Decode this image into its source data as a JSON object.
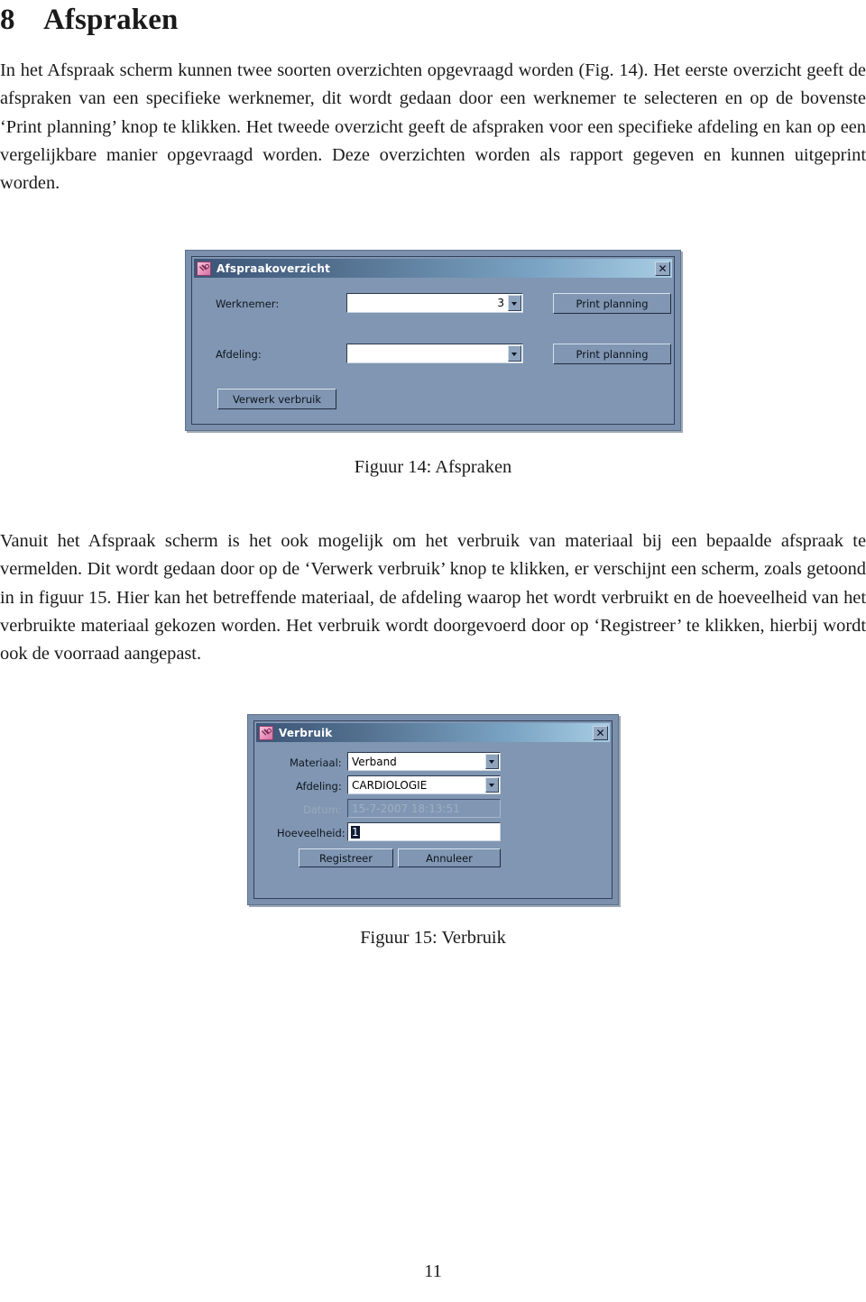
{
  "document": {
    "section_number": "8",
    "section_title": "Afspraken",
    "paragraph_1": "In het Afspraak scherm kunnen twee soorten overzichten opgevraagd worden (Fig. 14). Het eerste overzicht geeft de afspraken van een specifieke werknemer, dit wordt gedaan door een werknemer te selecteren en op de bovenste ‘Print planning’ knop te klikken. Het tweede overzicht geeft de afspraken voor een specifieke afdeling en kan op een vergelijkbare manier opgevraagd worden. Deze overzichten worden als rapport gegeven en kunnen uitgeprint worden.",
    "figure_14_caption": "Figuur 14: Afspraken",
    "paragraph_2": "Vanuit het Afspraak scherm is het ook mogelijk om het verbruik van materiaal bij een bepaalde afspraak te vermelden. Dit wordt gedaan door op de ‘Verwerk verbruik’ knop te klikken, er verschijnt een scherm, zoals getoond in in figuur 15. Hier kan het betreffende materiaal, de afdeling waarop het wordt verbruikt en de hoeveelheid van het verbruikte materiaal gekozen worden. Het verbruik wordt doorgevoerd door op ‘Registreer’ te klikken, hierbij wordt ook de voorraad aangepast.",
    "figure_15_caption": "Figuur 15: Verbruik",
    "page_number": "11"
  },
  "dialog_afspraakoverzicht": {
    "title": "Afspraakoverzicht",
    "icon": "key-icon",
    "close_label": "✕",
    "werknemer_label": "Werknemer:",
    "werknemer_value": "3",
    "afdeling_label": "Afdeling:",
    "afdeling_value": "",
    "print_planning_werknemer": "Print planning",
    "print_planning_afdeling": "Print planning",
    "verwerk_verbruik": "Verwerk verbruik"
  },
  "dialog_verbruik": {
    "title": "Verbruik",
    "icon": "key-icon",
    "close_label": "✕",
    "materiaal_label": "Materiaal:",
    "materiaal_value": "Verband",
    "afdeling_label": "Afdeling:",
    "afdeling_value": "CARDIOLOGIE",
    "datum_label": "Datum:",
    "datum_value": "15-7-2007 18:13:51",
    "hoeveelheid_label": "Hoeveelheid:",
    "hoeveelheid_value": "1",
    "registreer_label": "Registreer",
    "annuleer_label": "Annuleer"
  },
  "colors": {
    "dialog_face": "#8096b2",
    "title_gradient_start": "#3c5577",
    "title_gradient_end": "#a8cde4",
    "icon_pink": "#e993bd",
    "field_white": "#ffffff",
    "disabled_text": "#9fb0c5"
  }
}
